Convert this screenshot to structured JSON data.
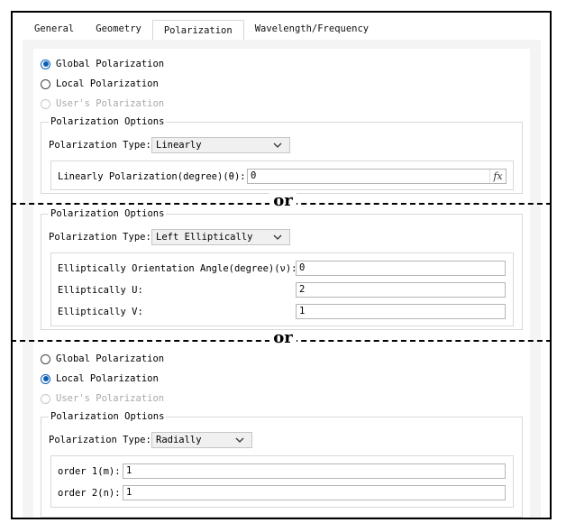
{
  "tabs": [
    "General",
    "Geometry",
    "Polarization",
    "Wavelength/Frequency"
  ],
  "active_tab": "Polarization",
  "section1": {
    "radios": [
      {
        "label": "Global Polarization",
        "state": "selected"
      },
      {
        "label": "Local Polarization",
        "state": "unselected"
      },
      {
        "label": "User's Polarization",
        "state": "disabled"
      }
    ],
    "group_title": "Polarization Options",
    "type_label": "Polarization Type:",
    "type_value": "Linearly",
    "field_label": "Linearly Polarization(degree)(θ):",
    "field_value": "0",
    "fx_label": "fx"
  },
  "separator_text": "or",
  "section2": {
    "group_title": "Polarization Options",
    "type_label": "Polarization Type:",
    "type_value": "Left Elliptically",
    "fields": [
      {
        "label": "Elliptically Orientation Angle(degree)(ν):",
        "value": "0"
      },
      {
        "label": "Elliptically U:",
        "value": "2"
      },
      {
        "label": "Elliptically V:",
        "value": "1"
      }
    ]
  },
  "section3": {
    "radios": [
      {
        "label": "Global Polarization",
        "state": "unselected"
      },
      {
        "label": "Local Polarization",
        "state": "selected"
      },
      {
        "label": "User's Polarization",
        "state": "disabled"
      }
    ],
    "group_title": "Polarization Options",
    "type_label": "Polarization Type:",
    "type_value": "Radially",
    "fields": [
      {
        "label": "order 1(m):",
        "value": "1"
      },
      {
        "label": "order 2(n):",
        "value": "1"
      }
    ]
  },
  "colors": {
    "accent": "#0a5fb4",
    "panel_bg": "#f4f4f4",
    "border": "#d8d8d8"
  }
}
